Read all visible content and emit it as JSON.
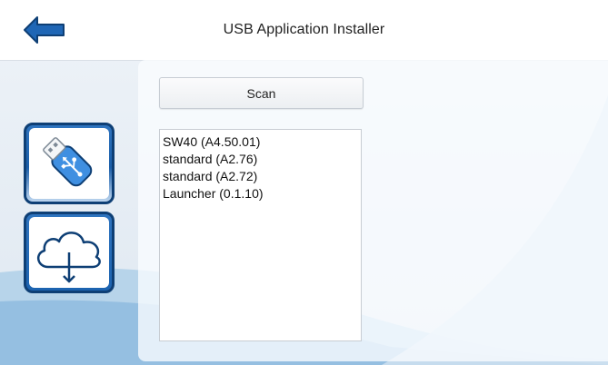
{
  "header": {
    "title": "USB Application Installer",
    "back_icon": "left-arrow-icon"
  },
  "toolbar": {
    "scan_label": "Scan"
  },
  "sidebar": {
    "items": [
      {
        "icon": "usb-flash-drive-icon"
      },
      {
        "icon": "cloud-download-icon"
      }
    ]
  },
  "applications": [
    "SW40 (A4.50.01)",
    "standard (A2.76)",
    "standard (A2.72)",
    "Launcher (0.1.10)"
  ],
  "colors": {
    "accent_blue": "#1f66b5",
    "dark_blue": "#0e3f75",
    "background": "#e7eef5"
  }
}
